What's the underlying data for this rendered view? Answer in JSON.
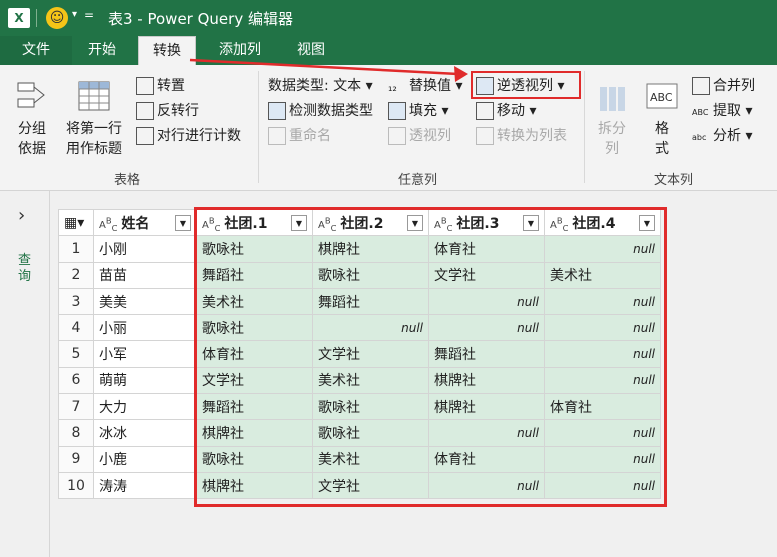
{
  "titlebar": {
    "app_icon": "X",
    "dd": "▾",
    "eq": "=",
    "title": "表3 - Power Query 编辑器"
  },
  "tabs": [
    "文件",
    "开始",
    "转换",
    "添加列",
    "视图"
  ],
  "ribbon": {
    "groups": [
      "表格",
      "任意列",
      "文本列"
    ],
    "table_group": {
      "group_by": "分组\n依据",
      "first_row_header": "将第一行\n用作标题",
      "transpose": "转置",
      "reverse_rows": "反转行",
      "count_rows": "对行进行计数"
    },
    "any_column": {
      "data_type": "数据类型: 文本",
      "detect_type": "检测数据类型",
      "rename": "重命名",
      "replace_values": "替换值",
      "fill": "填充",
      "pivot": "透视列",
      "unpivot": "逆透视列",
      "move": "移动",
      "convert_list": "转换为列表"
    },
    "text_column": {
      "split": "拆分\n列",
      "format": "格\n式",
      "merge": "合并列",
      "extract": "提取",
      "parse": "分析"
    }
  },
  "side": {
    "label": "查询"
  },
  "table": {
    "columns": [
      "姓名",
      "社团.1",
      "社团.2",
      "社团.3",
      "社团.4"
    ],
    "rows": [
      [
        "1",
        "小刚",
        "歌咏社",
        "棋牌社",
        "体育社",
        "null"
      ],
      [
        "2",
        "苗苗",
        "舞蹈社",
        "歌咏社",
        "文学社",
        "美术社"
      ],
      [
        "3",
        "美美",
        "美术社",
        "舞蹈社",
        "null",
        "null"
      ],
      [
        "4",
        "小丽",
        "歌咏社",
        "null",
        "null",
        "null"
      ],
      [
        "5",
        "小军",
        "体育社",
        "文学社",
        "舞蹈社",
        "null"
      ],
      [
        "6",
        "萌萌",
        "文学社",
        "美术社",
        "棋牌社",
        "null"
      ],
      [
        "7",
        "大力",
        "舞蹈社",
        "歌咏社",
        "棋牌社",
        "体育社"
      ],
      [
        "8",
        "冰冰",
        "棋牌社",
        "歌咏社",
        "null",
        "null"
      ],
      [
        "9",
        "小鹿",
        "歌咏社",
        "美术社",
        "体育社",
        "null"
      ],
      [
        "10",
        "涛涛",
        "棋牌社",
        "文学社",
        "null",
        "null"
      ]
    ]
  },
  "colors": {
    "accent": "#217346",
    "highlight": "#e02b2b",
    "selected": "#d9ecdf"
  }
}
